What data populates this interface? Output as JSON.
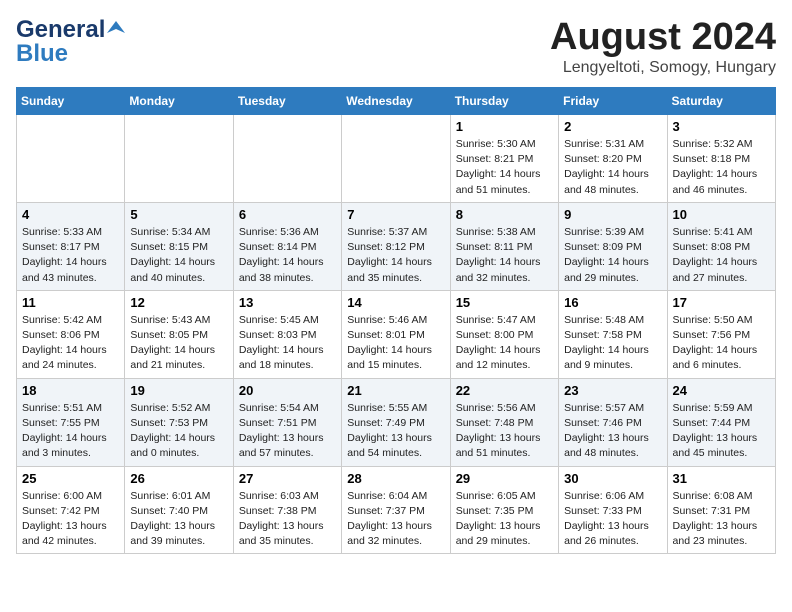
{
  "header": {
    "logo_line1": "General",
    "logo_line2": "Blue",
    "month_title": "August 2024",
    "location": "Lengyeltoti, Somogy, Hungary"
  },
  "days_of_week": [
    "Sunday",
    "Monday",
    "Tuesday",
    "Wednesday",
    "Thursday",
    "Friday",
    "Saturday"
  ],
  "weeks": [
    [
      {
        "day": "",
        "info": ""
      },
      {
        "day": "",
        "info": ""
      },
      {
        "day": "",
        "info": ""
      },
      {
        "day": "",
        "info": ""
      },
      {
        "day": "1",
        "info": "Sunrise: 5:30 AM\nSunset: 8:21 PM\nDaylight: 14 hours\nand 51 minutes."
      },
      {
        "day": "2",
        "info": "Sunrise: 5:31 AM\nSunset: 8:20 PM\nDaylight: 14 hours\nand 48 minutes."
      },
      {
        "day": "3",
        "info": "Sunrise: 5:32 AM\nSunset: 8:18 PM\nDaylight: 14 hours\nand 46 minutes."
      }
    ],
    [
      {
        "day": "4",
        "info": "Sunrise: 5:33 AM\nSunset: 8:17 PM\nDaylight: 14 hours\nand 43 minutes."
      },
      {
        "day": "5",
        "info": "Sunrise: 5:34 AM\nSunset: 8:15 PM\nDaylight: 14 hours\nand 40 minutes."
      },
      {
        "day": "6",
        "info": "Sunrise: 5:36 AM\nSunset: 8:14 PM\nDaylight: 14 hours\nand 38 minutes."
      },
      {
        "day": "7",
        "info": "Sunrise: 5:37 AM\nSunset: 8:12 PM\nDaylight: 14 hours\nand 35 minutes."
      },
      {
        "day": "8",
        "info": "Sunrise: 5:38 AM\nSunset: 8:11 PM\nDaylight: 14 hours\nand 32 minutes."
      },
      {
        "day": "9",
        "info": "Sunrise: 5:39 AM\nSunset: 8:09 PM\nDaylight: 14 hours\nand 29 minutes."
      },
      {
        "day": "10",
        "info": "Sunrise: 5:41 AM\nSunset: 8:08 PM\nDaylight: 14 hours\nand 27 minutes."
      }
    ],
    [
      {
        "day": "11",
        "info": "Sunrise: 5:42 AM\nSunset: 8:06 PM\nDaylight: 14 hours\nand 24 minutes."
      },
      {
        "day": "12",
        "info": "Sunrise: 5:43 AM\nSunset: 8:05 PM\nDaylight: 14 hours\nand 21 minutes."
      },
      {
        "day": "13",
        "info": "Sunrise: 5:45 AM\nSunset: 8:03 PM\nDaylight: 14 hours\nand 18 minutes."
      },
      {
        "day": "14",
        "info": "Sunrise: 5:46 AM\nSunset: 8:01 PM\nDaylight: 14 hours\nand 15 minutes."
      },
      {
        "day": "15",
        "info": "Sunrise: 5:47 AM\nSunset: 8:00 PM\nDaylight: 14 hours\nand 12 minutes."
      },
      {
        "day": "16",
        "info": "Sunrise: 5:48 AM\nSunset: 7:58 PM\nDaylight: 14 hours\nand 9 minutes."
      },
      {
        "day": "17",
        "info": "Sunrise: 5:50 AM\nSunset: 7:56 PM\nDaylight: 14 hours\nand 6 minutes."
      }
    ],
    [
      {
        "day": "18",
        "info": "Sunrise: 5:51 AM\nSunset: 7:55 PM\nDaylight: 14 hours\nand 3 minutes."
      },
      {
        "day": "19",
        "info": "Sunrise: 5:52 AM\nSunset: 7:53 PM\nDaylight: 14 hours\nand 0 minutes."
      },
      {
        "day": "20",
        "info": "Sunrise: 5:54 AM\nSunset: 7:51 PM\nDaylight: 13 hours\nand 57 minutes."
      },
      {
        "day": "21",
        "info": "Sunrise: 5:55 AM\nSunset: 7:49 PM\nDaylight: 13 hours\nand 54 minutes."
      },
      {
        "day": "22",
        "info": "Sunrise: 5:56 AM\nSunset: 7:48 PM\nDaylight: 13 hours\nand 51 minutes."
      },
      {
        "day": "23",
        "info": "Sunrise: 5:57 AM\nSunset: 7:46 PM\nDaylight: 13 hours\nand 48 minutes."
      },
      {
        "day": "24",
        "info": "Sunrise: 5:59 AM\nSunset: 7:44 PM\nDaylight: 13 hours\nand 45 minutes."
      }
    ],
    [
      {
        "day": "25",
        "info": "Sunrise: 6:00 AM\nSunset: 7:42 PM\nDaylight: 13 hours\nand 42 minutes."
      },
      {
        "day": "26",
        "info": "Sunrise: 6:01 AM\nSunset: 7:40 PM\nDaylight: 13 hours\nand 39 minutes."
      },
      {
        "day": "27",
        "info": "Sunrise: 6:03 AM\nSunset: 7:38 PM\nDaylight: 13 hours\nand 35 minutes."
      },
      {
        "day": "28",
        "info": "Sunrise: 6:04 AM\nSunset: 7:37 PM\nDaylight: 13 hours\nand 32 minutes."
      },
      {
        "day": "29",
        "info": "Sunrise: 6:05 AM\nSunset: 7:35 PM\nDaylight: 13 hours\nand 29 minutes."
      },
      {
        "day": "30",
        "info": "Sunrise: 6:06 AM\nSunset: 7:33 PM\nDaylight: 13 hours\nand 26 minutes."
      },
      {
        "day": "31",
        "info": "Sunrise: 6:08 AM\nSunset: 7:31 PM\nDaylight: 13 hours\nand 23 minutes."
      }
    ]
  ]
}
